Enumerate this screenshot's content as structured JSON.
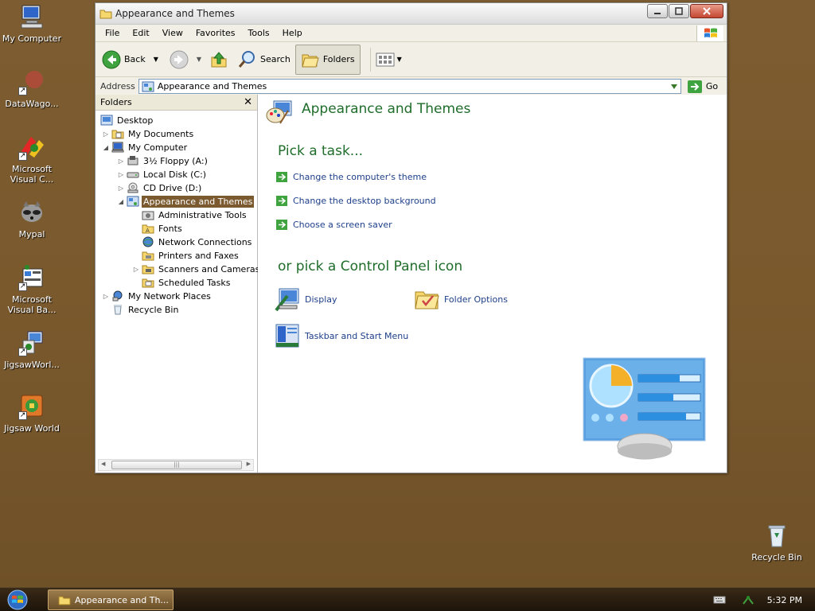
{
  "desktop": {
    "icons": [
      {
        "label": "My Computer"
      },
      {
        "label": "DataWago..."
      },
      {
        "label": "Microsoft Visual C..."
      },
      {
        "label": "Mypal"
      },
      {
        "label": "Microsoft Visual Ba..."
      },
      {
        "label": "JigsawWorl..."
      },
      {
        "label": "Jigsaw World"
      },
      {
        "label": "Recycle Bin"
      }
    ]
  },
  "window": {
    "title": "Appearance and Themes",
    "menu": [
      "File",
      "Edit",
      "View",
      "Favorites",
      "Tools",
      "Help"
    ],
    "toolbar": {
      "back": "Back",
      "search": "Search",
      "folders": "Folders"
    },
    "address": {
      "label": "Address",
      "value": "Appearance and Themes",
      "go": "Go"
    },
    "folders_pane": {
      "title": "Folders",
      "tree": [
        {
          "label": "Desktop"
        },
        {
          "label": "My Documents"
        },
        {
          "label": "My Computer"
        },
        {
          "label": "3½ Floppy (A:)"
        },
        {
          "label": "Local Disk (C:)"
        },
        {
          "label": "CD Drive (D:)"
        },
        {
          "label": "Appearance and Themes"
        },
        {
          "label": "Administrative Tools"
        },
        {
          "label": "Fonts"
        },
        {
          "label": "Network Connections"
        },
        {
          "label": "Printers and Faxes"
        },
        {
          "label": "Scanners and Cameras"
        },
        {
          "label": "Scheduled Tasks"
        },
        {
          "label": "My Network Places"
        },
        {
          "label": "Recycle Bin"
        }
      ]
    },
    "content": {
      "heading": "Appearance and Themes",
      "pick_task": "Pick a task...",
      "tasks": [
        "Change the computer's theme",
        "Change the desktop background",
        "Choose a screen saver"
      ],
      "pick_icon": "or pick a Control Panel icon",
      "icons": [
        "Display",
        "Folder Options",
        "Taskbar and Start Menu"
      ]
    }
  },
  "taskbar": {
    "task_label": "Appearance and Th...",
    "clock": "5:32 PM"
  },
  "colors": {
    "desktop": "#7a5a2e",
    "heading_green": "#1f6d2a",
    "link_blue": "#1e3f8a",
    "selection": "#7a5a2e"
  }
}
